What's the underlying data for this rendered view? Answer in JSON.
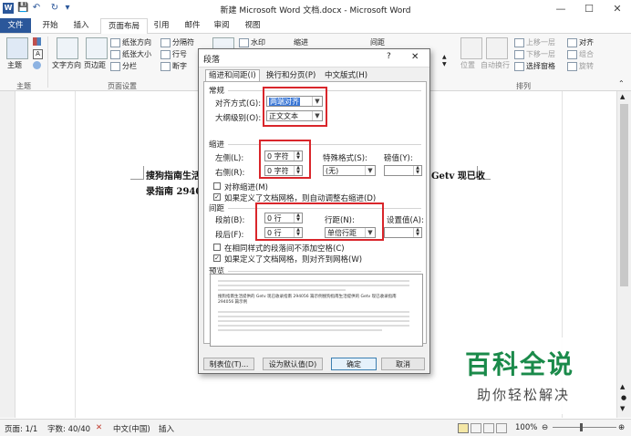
{
  "window": {
    "title": "新建 Microsoft Word 文档.docx - Microsoft Word",
    "word_icon": "W",
    "minimize": "—",
    "restore": "☐",
    "close": "✕"
  },
  "tabs": [
    "文件",
    "开始",
    "插入",
    "页面布局",
    "引用",
    "邮件",
    "审阅",
    "视图"
  ],
  "ribbon": {
    "theme": "主题",
    "text_direction": "文字方向",
    "margins": "页边距",
    "orientation": "纸张方向",
    "size": "纸张大小",
    "columns": "分栏",
    "breaks": "分隔符",
    "line_numbers": "行号",
    "hyphenation": "断字",
    "watermark": "水印",
    "indent": "缩进",
    "spacing": "间距",
    "position": "位置",
    "wrap_text": "自动换行",
    "bring_forward": "上移一层",
    "send_backward": "下移一层",
    "selection_pane": "选择窗格",
    "align": "对齐",
    "group": "组合",
    "rotate": "旋转",
    "group_theme": "主题",
    "group_page_setup": "页面设置",
    "group_arrange": "排列"
  },
  "document": {
    "line1_left": "搜狗指南生活",
    "line1_right": "Getv 现已收",
    "line2": "录指南 294056"
  },
  "dialog": {
    "title": "段落",
    "help": "?",
    "close": "✕",
    "tabs": [
      "缩进和间距(I)",
      "换行和分页(P)",
      "中文版式(H)"
    ],
    "general_section": "常规",
    "alignment_label": "对齐方式(G):",
    "alignment_value": "两端对齐",
    "outline_label": "大纲级别(O):",
    "outline_value": "正文文本",
    "indent_section": "缩进",
    "left_label": "左侧(L):",
    "left_value": "0 字符",
    "right_label": "右侧(R):",
    "right_value": "0 字符",
    "special_label": "特殊格式(S):",
    "special_value": "(无)",
    "measure_label": "磅值(Y):",
    "mirror_indent": "对称缩进(M)",
    "auto_adjust_indent": "如果定义了文档网格，则自动调整右缩进(D)",
    "spacing_section": "间距",
    "before_label": "段前(B):",
    "before_value": "0 行",
    "after_label": "段后(F):",
    "after_value": "0 行",
    "line_spacing_label": "行距(N):",
    "line_spacing_value": "单倍行距",
    "setting_label": "设置值(A):",
    "no_space_same_style": "在相同样式的段落间不添加空格(C)",
    "snap_to_grid": "如果定义了文档网格，则对齐到网格(W)",
    "preview_section": "预览",
    "preview_text": "搜狗指南生活提供的 Getv 现已收录指南 294056 篇示例搜狗指南生活提供的 Getv 现已收录指南 294056 篇示例",
    "tabs_button": "制表位(T)...",
    "default_button": "设为默认值(D)",
    "ok_button": "确定",
    "cancel_button": "取消"
  },
  "status": {
    "page": "页面: 1/1",
    "words": "字数: 40/40",
    "language": "中文(中国)",
    "mode": "插入",
    "zoom": "100%",
    "zoom_minus": "⊖",
    "zoom_plus": "⊕"
  },
  "watermark": {
    "main": "百科全说",
    "sub": "助你轻松解决"
  },
  "colors": {
    "accent": "#2b579a",
    "highlight_box": "#d9262b",
    "watermark_green": "#1a8a4a"
  }
}
